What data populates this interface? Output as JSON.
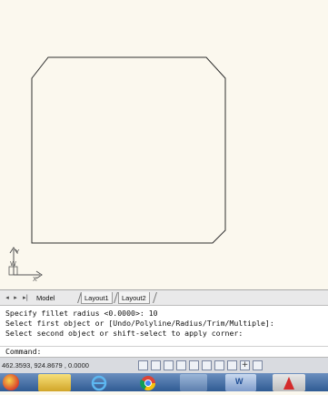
{
  "tabs": {
    "nav_first": "◂",
    "nav_prev": "▸",
    "nav_last": "▸|",
    "items": [
      {
        "label": "Model",
        "active": true
      },
      {
        "label": "Layout1",
        "active": false
      },
      {
        "label": "Layout2",
        "active": false
      }
    ]
  },
  "command_history": [
    "Specify fillet radius <0.0000>: 10",
    "Select first object or [Undo/Polyline/Radius/Trim/Multiple]:",
    "Select second object or shift-select to apply corner:"
  ],
  "command_prompt": "Command:",
  "status": {
    "coordinates": "462.3593, 924.8679 , 0.0000",
    "toggles": [
      "snap-icon",
      "grid-icon",
      "ortho-icon",
      "polar-icon",
      "osnap-icon",
      "otrack-icon",
      "ducs-icon",
      "dyn-icon",
      "lineweight-icon",
      "qp-icon"
    ]
  },
  "ucs": {
    "y_label": "Y",
    "x_label": "X",
    "w_label": "W"
  },
  "taskbar": {
    "apps": [
      "start-orb-icon",
      "file-explorer-icon",
      "internet-explorer-icon",
      "chrome-icon",
      "app-window-icon",
      "word-icon",
      "autocad-icon"
    ],
    "word_label": "W"
  },
  "colors": {
    "canvas": "#fbf8ee",
    "shape_stroke": "#2f2f2f",
    "statusbar": "#d9dbe0",
    "taskbar": "#2f5b93"
  }
}
